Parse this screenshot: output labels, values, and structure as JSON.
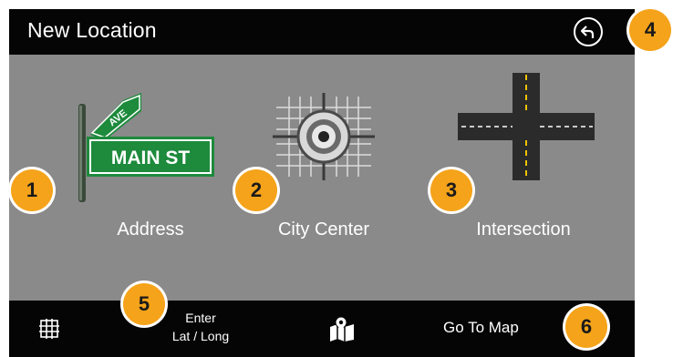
{
  "header": {
    "title": "New Location",
    "back_icon": "back-arrow-icon"
  },
  "options": [
    {
      "label": "Address",
      "icon": "street-sign-icon",
      "sign_main": "MAIN ST",
      "sign_cross": "AVE"
    },
    {
      "label": "City Center",
      "icon": "city-center-target-icon"
    },
    {
      "label": "Intersection",
      "icon": "intersection-icon"
    }
  ],
  "bottom_bar": {
    "latlong_icon": "coordinate-grid-icon",
    "latlong_line1": "Enter",
    "latlong_line2": "Lat / Long",
    "map_icon": "folded-map-icon",
    "goto_map": "Go To Map"
  },
  "callouts": [
    "1",
    "2",
    "3",
    "4",
    "5",
    "6"
  ],
  "colors": {
    "callout": "#f5a31a",
    "bar": "#050505",
    "panel": "#8a8a8a",
    "sign_green": "#1d8a3c"
  }
}
